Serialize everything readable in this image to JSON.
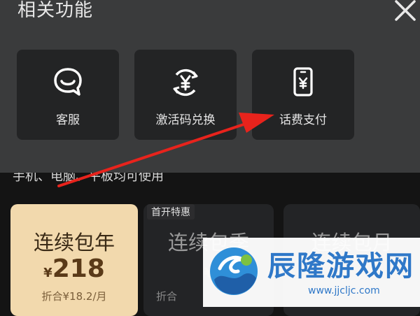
{
  "panel": {
    "title": "相关功能",
    "tiles": [
      {
        "label": "客服",
        "icon": "customer-service-icon"
      },
      {
        "label": "激活码兑换",
        "icon": "yuan-exchange-icon"
      },
      {
        "label": "话费支付",
        "icon": "phone-payment-icon"
      }
    ]
  },
  "subscription": {
    "description": "手机、电脑、平板均可使用",
    "badge": "首开特惠",
    "plans": [
      {
        "name": "连续包年",
        "currency": "¥",
        "price": "218",
        "per": "折合¥18.2/月"
      },
      {
        "name": "连续包季",
        "currency": "¥",
        "price": "",
        "per": "折合"
      },
      {
        "name": "连续包月"
      }
    ]
  },
  "watermark": {
    "title": "辰隆游戏网",
    "url": "www.jjcljc.com"
  },
  "colors": {
    "panel": "#3a3b3c",
    "tile": "#232425",
    "gold_card": "#f2d9ad",
    "arrow": "#e8231c",
    "watermark_text": "#2f78c8"
  }
}
